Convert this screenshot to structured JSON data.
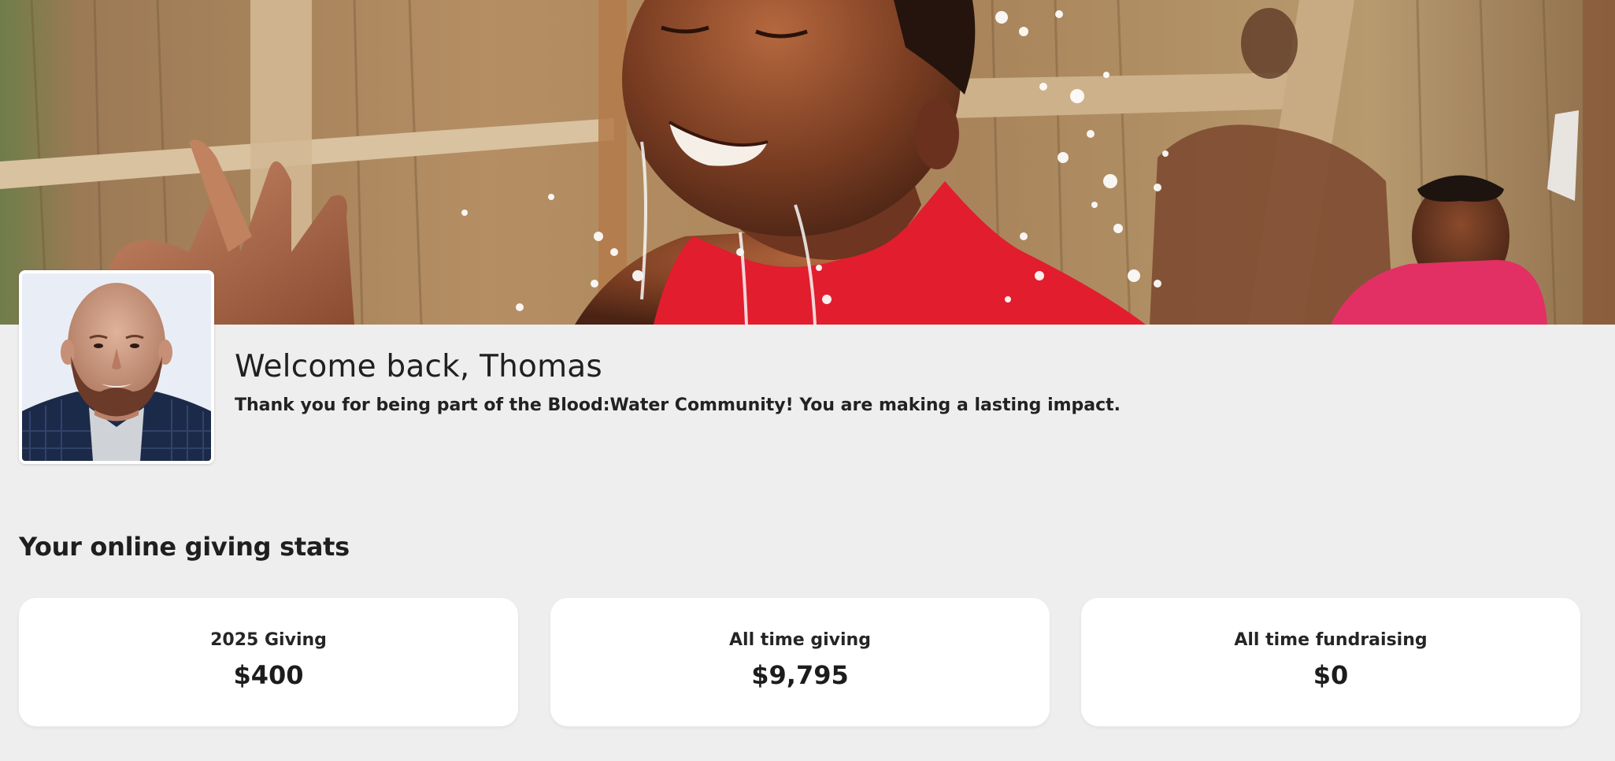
{
  "profile": {
    "welcome": "Welcome back, Thomas",
    "subtitle": "Thank you for being part of the Blood:Water Community! You are making a lasting impact."
  },
  "stats": {
    "heading": "Your online giving stats",
    "cards": [
      {
        "label": "2025 Giving",
        "value": "$400"
      },
      {
        "label": "All time giving",
        "value": "$9,795"
      },
      {
        "label": "All time fundraising",
        "value": "$0"
      }
    ]
  },
  "colors": {
    "page_background": "#eeeeee",
    "card_background": "#ffffff",
    "text": "#1f1f1f",
    "accent_red": "#e11d2e"
  }
}
